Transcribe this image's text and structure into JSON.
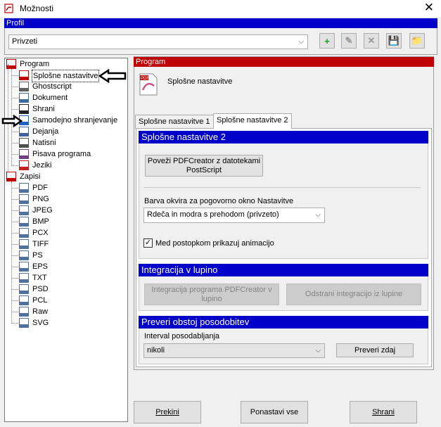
{
  "window": {
    "title": "Možnosti",
    "close_glyph": "✕"
  },
  "profile": {
    "header": "Profil",
    "selected": "Privzeti",
    "toolbar": [
      {
        "name": "add-profile-icon",
        "glyph": "+"
      },
      {
        "name": "rename-profile-icon",
        "glyph": "✎"
      },
      {
        "name": "delete-profile-icon",
        "glyph": "✕"
      },
      {
        "name": "save-profile-icon",
        "glyph": "💾"
      },
      {
        "name": "open-profile-icon",
        "glyph": "📁"
      }
    ]
  },
  "tree": {
    "program_label": "Program",
    "program_items": [
      "Splošne nastavitve",
      "Ghostscript",
      "Dokument",
      "Shrani",
      "Samodejno shranjevanje",
      "Dejanja",
      "Natisni",
      "Pisava programa",
      "Jeziki"
    ],
    "formats_label": "Zapisi",
    "format_items": [
      "PDF",
      "PNG",
      "JPEG",
      "BMP",
      "PCX",
      "TIFF",
      "PS",
      "EPS",
      "TXT",
      "PSD",
      "PCL",
      "Raw",
      "SVG"
    ]
  },
  "panel": {
    "header": "Program",
    "title": "Splošne nastavitve",
    "tabs": [
      "Splošne nastavitve 1",
      "Splošne nastavitve 2"
    ],
    "active_tab": 1
  },
  "general2": {
    "header": "Splošne nastavitve 2",
    "associate_button": "Poveži PDFCreator z datotekami PostScript",
    "frame_color_label": "Barva okvira za pogovorno okno Nastavitve",
    "frame_color_value": "Rdeča in modra s prehodom (privzeto)",
    "animation_label": "Med postopkom prikazuj animacijo",
    "animation_checked": true
  },
  "integration": {
    "header": "Integracija v lupino",
    "integrate_button": "Integracija programa PDFCreator v lupino",
    "remove_button": "Odstrani integracijo iz lupine"
  },
  "updates": {
    "header": "Preveri obstoj posodobitev",
    "interval_label": "Interval posodabljanja",
    "interval_value": "nikoli",
    "check_button": "Preveri zdaj"
  },
  "footer": {
    "cancel": "Prekini",
    "reset": "Ponastavi vse",
    "save": "Shrani"
  },
  "colors": {
    "accent_blue": "#0000c8",
    "accent_red": "#c00000"
  }
}
